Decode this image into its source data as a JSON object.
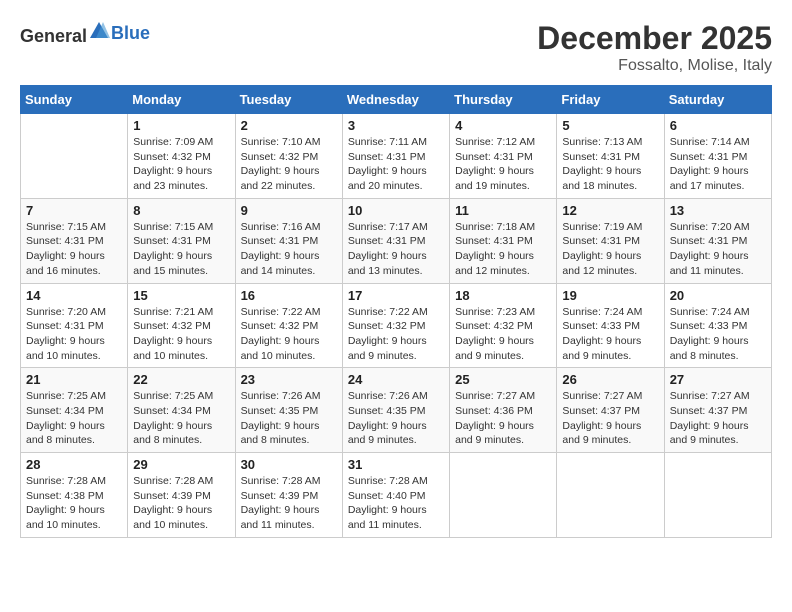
{
  "header": {
    "logo_general": "General",
    "logo_blue": "Blue",
    "month": "December 2025",
    "location": "Fossalto, Molise, Italy"
  },
  "weekdays": [
    "Sunday",
    "Monday",
    "Tuesday",
    "Wednesday",
    "Thursday",
    "Friday",
    "Saturday"
  ],
  "weeks": [
    [
      {
        "day": "",
        "sunrise": "",
        "sunset": "",
        "daylight": ""
      },
      {
        "day": "1",
        "sunrise": "Sunrise: 7:09 AM",
        "sunset": "Sunset: 4:32 PM",
        "daylight": "Daylight: 9 hours and 23 minutes."
      },
      {
        "day": "2",
        "sunrise": "Sunrise: 7:10 AM",
        "sunset": "Sunset: 4:32 PM",
        "daylight": "Daylight: 9 hours and 22 minutes."
      },
      {
        "day": "3",
        "sunrise": "Sunrise: 7:11 AM",
        "sunset": "Sunset: 4:31 PM",
        "daylight": "Daylight: 9 hours and 20 minutes."
      },
      {
        "day": "4",
        "sunrise": "Sunrise: 7:12 AM",
        "sunset": "Sunset: 4:31 PM",
        "daylight": "Daylight: 9 hours and 19 minutes."
      },
      {
        "day": "5",
        "sunrise": "Sunrise: 7:13 AM",
        "sunset": "Sunset: 4:31 PM",
        "daylight": "Daylight: 9 hours and 18 minutes."
      },
      {
        "day": "6",
        "sunrise": "Sunrise: 7:14 AM",
        "sunset": "Sunset: 4:31 PM",
        "daylight": "Daylight: 9 hours and 17 minutes."
      }
    ],
    [
      {
        "day": "7",
        "sunrise": "Sunrise: 7:15 AM",
        "sunset": "Sunset: 4:31 PM",
        "daylight": "Daylight: 9 hours and 16 minutes."
      },
      {
        "day": "8",
        "sunrise": "Sunrise: 7:15 AM",
        "sunset": "Sunset: 4:31 PM",
        "daylight": "Daylight: 9 hours and 15 minutes."
      },
      {
        "day": "9",
        "sunrise": "Sunrise: 7:16 AM",
        "sunset": "Sunset: 4:31 PM",
        "daylight": "Daylight: 9 hours and 14 minutes."
      },
      {
        "day": "10",
        "sunrise": "Sunrise: 7:17 AM",
        "sunset": "Sunset: 4:31 PM",
        "daylight": "Daylight: 9 hours and 13 minutes."
      },
      {
        "day": "11",
        "sunrise": "Sunrise: 7:18 AM",
        "sunset": "Sunset: 4:31 PM",
        "daylight": "Daylight: 9 hours and 12 minutes."
      },
      {
        "day": "12",
        "sunrise": "Sunrise: 7:19 AM",
        "sunset": "Sunset: 4:31 PM",
        "daylight": "Daylight: 9 hours and 12 minutes."
      },
      {
        "day": "13",
        "sunrise": "Sunrise: 7:20 AM",
        "sunset": "Sunset: 4:31 PM",
        "daylight": "Daylight: 9 hours and 11 minutes."
      }
    ],
    [
      {
        "day": "14",
        "sunrise": "Sunrise: 7:20 AM",
        "sunset": "Sunset: 4:31 PM",
        "daylight": "Daylight: 9 hours and 10 minutes."
      },
      {
        "day": "15",
        "sunrise": "Sunrise: 7:21 AM",
        "sunset": "Sunset: 4:32 PM",
        "daylight": "Daylight: 9 hours and 10 minutes."
      },
      {
        "day": "16",
        "sunrise": "Sunrise: 7:22 AM",
        "sunset": "Sunset: 4:32 PM",
        "daylight": "Daylight: 9 hours and 10 minutes."
      },
      {
        "day": "17",
        "sunrise": "Sunrise: 7:22 AM",
        "sunset": "Sunset: 4:32 PM",
        "daylight": "Daylight: 9 hours and 9 minutes."
      },
      {
        "day": "18",
        "sunrise": "Sunrise: 7:23 AM",
        "sunset": "Sunset: 4:32 PM",
        "daylight": "Daylight: 9 hours and 9 minutes."
      },
      {
        "day": "19",
        "sunrise": "Sunrise: 7:24 AM",
        "sunset": "Sunset: 4:33 PM",
        "daylight": "Daylight: 9 hours and 9 minutes."
      },
      {
        "day": "20",
        "sunrise": "Sunrise: 7:24 AM",
        "sunset": "Sunset: 4:33 PM",
        "daylight": "Daylight: 9 hours and 8 minutes."
      }
    ],
    [
      {
        "day": "21",
        "sunrise": "Sunrise: 7:25 AM",
        "sunset": "Sunset: 4:34 PM",
        "daylight": "Daylight: 9 hours and 8 minutes."
      },
      {
        "day": "22",
        "sunrise": "Sunrise: 7:25 AM",
        "sunset": "Sunset: 4:34 PM",
        "daylight": "Daylight: 9 hours and 8 minutes."
      },
      {
        "day": "23",
        "sunrise": "Sunrise: 7:26 AM",
        "sunset": "Sunset: 4:35 PM",
        "daylight": "Daylight: 9 hours and 8 minutes."
      },
      {
        "day": "24",
        "sunrise": "Sunrise: 7:26 AM",
        "sunset": "Sunset: 4:35 PM",
        "daylight": "Daylight: 9 hours and 9 minutes."
      },
      {
        "day": "25",
        "sunrise": "Sunrise: 7:27 AM",
        "sunset": "Sunset: 4:36 PM",
        "daylight": "Daylight: 9 hours and 9 minutes."
      },
      {
        "day": "26",
        "sunrise": "Sunrise: 7:27 AM",
        "sunset": "Sunset: 4:37 PM",
        "daylight": "Daylight: 9 hours and 9 minutes."
      },
      {
        "day": "27",
        "sunrise": "Sunrise: 7:27 AM",
        "sunset": "Sunset: 4:37 PM",
        "daylight": "Daylight: 9 hours and 9 minutes."
      }
    ],
    [
      {
        "day": "28",
        "sunrise": "Sunrise: 7:28 AM",
        "sunset": "Sunset: 4:38 PM",
        "daylight": "Daylight: 9 hours and 10 minutes."
      },
      {
        "day": "29",
        "sunrise": "Sunrise: 7:28 AM",
        "sunset": "Sunset: 4:39 PM",
        "daylight": "Daylight: 9 hours and 10 minutes."
      },
      {
        "day": "30",
        "sunrise": "Sunrise: 7:28 AM",
        "sunset": "Sunset: 4:39 PM",
        "daylight": "Daylight: 9 hours and 11 minutes."
      },
      {
        "day": "31",
        "sunrise": "Sunrise: 7:28 AM",
        "sunset": "Sunset: 4:40 PM",
        "daylight": "Daylight: 9 hours and 11 minutes."
      },
      {
        "day": "",
        "sunrise": "",
        "sunset": "",
        "daylight": ""
      },
      {
        "day": "",
        "sunrise": "",
        "sunset": "",
        "daylight": ""
      },
      {
        "day": "",
        "sunrise": "",
        "sunset": "",
        "daylight": ""
      }
    ]
  ]
}
